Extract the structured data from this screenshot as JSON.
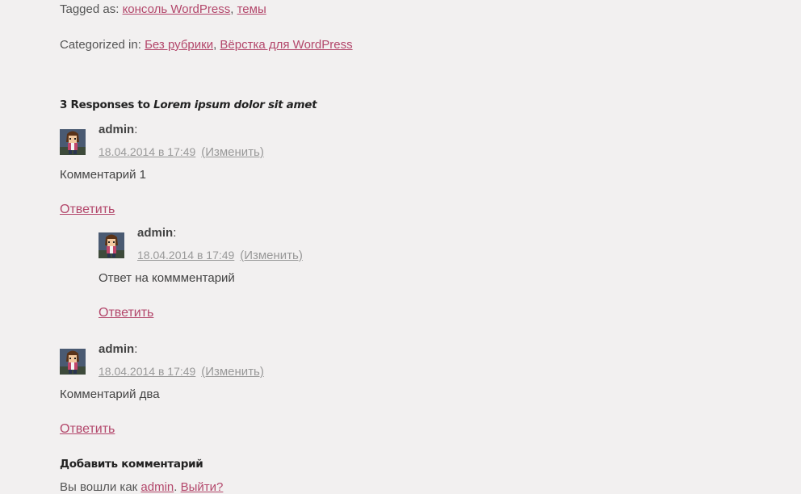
{
  "tags": {
    "label": "Tagged as:",
    "items": [
      "консоль WordPress",
      "темы"
    ],
    "separator": ","
  },
  "categories": {
    "label": "Categorized in:",
    "items": [
      "Без рубрики",
      "Вёрстка для WordPress"
    ],
    "separator": ","
  },
  "responses": {
    "prefix": "3 Responses to",
    "post_title": "Lorem ipsum dolor sit amet"
  },
  "comments": [
    {
      "author": "admin",
      "colon": ":",
      "date": "18.04.2014 в 17:49",
      "edit": "(Изменить)",
      "text": "Комментарий 1",
      "reply": "Ответить"
    },
    {
      "author": "admin",
      "colon": ":",
      "date": "18.04.2014 в 17:49",
      "edit": "(Изменить)",
      "text": "Ответ на коммментарий",
      "reply": "Ответить"
    },
    {
      "author": "admin",
      "colon": ":",
      "date": "18.04.2014 в 17:49",
      "edit": "(Изменить)",
      "text": "Комментарий два",
      "reply": "Ответить"
    }
  ],
  "add_comment": {
    "title": "Добавить комментарий",
    "logged_in_prefix": "Вы вошли как",
    "user": "admin",
    "separator": ".",
    "logout": "Выйти?"
  },
  "colors": {
    "background": "#f2f0f0",
    "link": "#b3476b",
    "muted_link": "#999999",
    "text": "#555555",
    "heading": "#222222"
  },
  "icons": {
    "avatar": "avatar-icon"
  }
}
